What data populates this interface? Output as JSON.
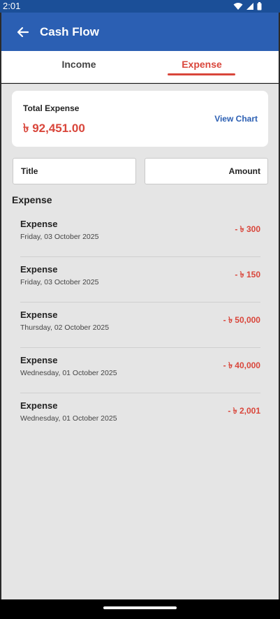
{
  "status_bar": {
    "time": "2:01",
    "icons": [
      "wifi-icon",
      "signal-icon",
      "battery-icon"
    ]
  },
  "app_bar": {
    "title": "Cash Flow",
    "back_icon": "arrow-left-icon"
  },
  "tabs": [
    {
      "label": "Income",
      "active": false
    },
    {
      "label": "Expense",
      "active": true
    }
  ],
  "summary": {
    "label": "Total Expense",
    "value": "৳ 92,451.00",
    "view_chart": "View Chart"
  },
  "table_header": {
    "title": "Title",
    "amount": "Amount"
  },
  "section_title": "Expense",
  "transactions": [
    {
      "name": "Expense",
      "date": "Friday, 03 October 2025",
      "amount": "- ৳ 300"
    },
    {
      "name": "Expense",
      "date": "Friday, 03 October 2025",
      "amount": "- ৳ 150"
    },
    {
      "name": "Expense",
      "date": "Thursday, 02 October 2025",
      "amount": "- ৳ 50,000"
    },
    {
      "name": "Expense",
      "date": "Wednesday, 01 October 2025",
      "amount": "- ৳ 40,000"
    },
    {
      "name": "Expense",
      "date": "Wednesday, 01 October 2025",
      "amount": "- ৳ 2,001"
    }
  ],
  "colors": {
    "primary": "#2b5fb3",
    "expense_red": "#d9463b",
    "background": "#e5e5e5"
  }
}
